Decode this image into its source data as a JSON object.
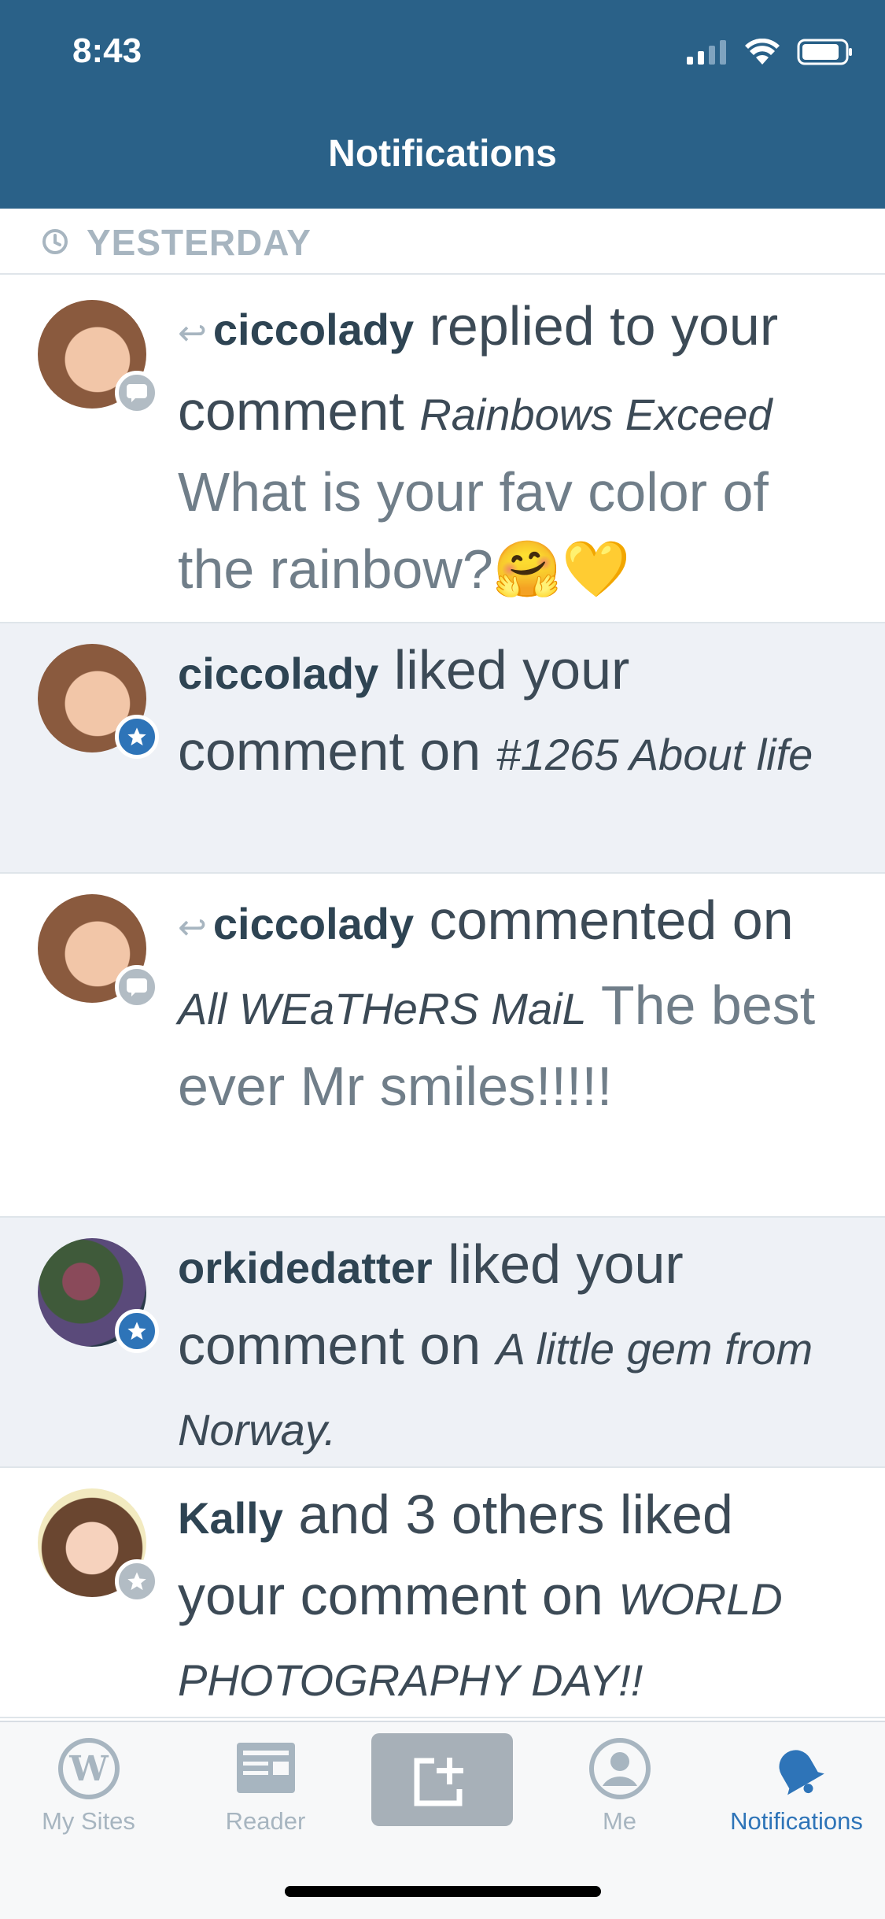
{
  "status_bar": {
    "time": "8:43"
  },
  "nav": {
    "title": "Notifications"
  },
  "section": {
    "label": "YESTERDAY"
  },
  "notifications": [
    {
      "user": "ciccolady",
      "action": "replied to your comment",
      "title": "Rainbows Exceed",
      "snippet": "What is your fav color of the rainbow?🤗💛",
      "badge": "comment-icon",
      "reply_icon": "↩",
      "unread": false
    },
    {
      "user": "ciccolady",
      "action": "liked your comment on",
      "title": "#1265 About life",
      "badge": "star-icon",
      "unread": true
    },
    {
      "user": "ciccolady",
      "action": "commented on",
      "title": "All WEaTHeRS MaiL",
      "snippet": "The best ever Mr smiles!!!!!",
      "badge": "comment-icon",
      "reply_icon": "↩",
      "unread": false
    },
    {
      "user": "orkidedatter",
      "action": "liked your comment on",
      "title": "A little gem from Norway.",
      "badge": "star-icon",
      "unread": true
    },
    {
      "user": "Kally",
      "action": "and 3 others liked your comment on",
      "title": "WORLD PHOTOGRAPHY DAY!!",
      "badge": "star-icon",
      "unread": false
    }
  ],
  "tabs": [
    {
      "label": "My Sites",
      "icon": "wordpress-icon"
    },
    {
      "label": "Reader",
      "icon": "reader-icon"
    },
    {
      "label": "",
      "icon": "write-icon"
    },
    {
      "label": "Me",
      "icon": "me-icon"
    },
    {
      "label": "Notifications",
      "icon": "bell-icon",
      "active": true
    }
  ],
  "colors": {
    "header": "#2a6188",
    "accent": "#2e74b8",
    "unread_bg": "#eef1f6",
    "muted": "#a7b5c0"
  }
}
